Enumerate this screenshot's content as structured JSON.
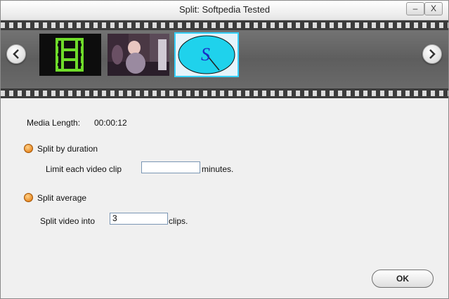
{
  "window": {
    "title": "Split: Softpedia Tested",
    "minimize_label": "–",
    "close_label": "X"
  },
  "filmstrip": {
    "prev_icon": "chevron-left-icon",
    "next_icon": "chevron-right-icon",
    "thumb_text": "S"
  },
  "media": {
    "label": "Media Length:",
    "value": "00:00:12"
  },
  "split_by_duration": {
    "label": "Split by duration",
    "limit_label": "Limit each video clip",
    "limit_value": "",
    "minutes_label": "minutes."
  },
  "split_average": {
    "label": "Split average",
    "into_label": "Split video into",
    "clips_value": "3",
    "clips_label": "clips."
  },
  "ok_label": "OK",
  "colors": {
    "accent": "#36d2ff",
    "radio": "#e07000"
  }
}
